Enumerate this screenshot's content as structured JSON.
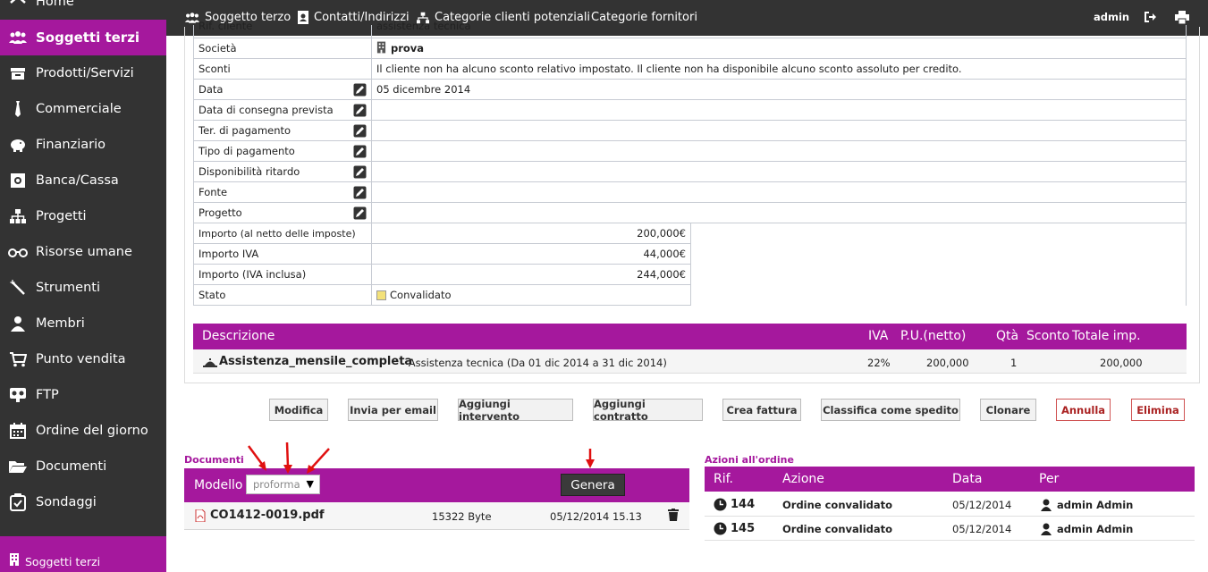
{
  "sidebar": {
    "items": [
      {
        "label": "Home",
        "icon": "home-icon"
      },
      {
        "label": "Soggetti terzi",
        "icon": "users-icon"
      },
      {
        "label": "Prodotti/Servizi",
        "icon": "box-icon"
      },
      {
        "label": "Commerciale",
        "icon": "tie-icon"
      },
      {
        "label": "Finanziario",
        "icon": "piggy-bank-icon"
      },
      {
        "label": "Banca/Cassa",
        "icon": "safe-icon"
      },
      {
        "label": "Progetti",
        "icon": "sitemap-icon"
      },
      {
        "label": "Risorse umane",
        "icon": "glasses-icon"
      },
      {
        "label": "Strumenti",
        "icon": "wand-icon"
      },
      {
        "label": "Membri",
        "icon": "member-icon"
      },
      {
        "label": "Punto vendita",
        "icon": "cart-icon"
      },
      {
        "label": "FTP",
        "icon": "ftp-icon"
      },
      {
        "label": "Ordine del giorno",
        "icon": "calendar-icon"
      },
      {
        "label": "Documenti",
        "icon": "folder-icon"
      },
      {
        "label": "Sondaggi",
        "icon": "survey-icon"
      }
    ],
    "bottom_label": "Soggetti terzi"
  },
  "topbar": {
    "nav": [
      "Soggetto terzo",
      "Contatti/Indirizzi",
      "Categorie clienti potenziali",
      "Categorie fornitori"
    ],
    "user": "admin"
  },
  "info": {
    "rif_label": "Rif. cliente",
    "rif_value": "assistenza tecnica",
    "societa_label": "Società",
    "societa_value": "prova",
    "sconti_label": "Sconti",
    "sconti_value": "Il cliente non ha alcuno sconto relativo impostato. Il cliente non ha disponibile alcuno sconto assoluto per credito.",
    "data_label": "Data",
    "data_value": "05 dicembre 2014",
    "consegna_label": "Data di consegna prevista",
    "termini_label": "Ter. di pagamento",
    "tipo_label": "Tipo di pagamento",
    "disp_label": "Disponibilità ritardo",
    "fonte_label": "Fonte",
    "progetto_label": "Progetto",
    "imp_netto_label": "Importo (al netto delle imposte)",
    "imp_netto_value": "200,000€",
    "imp_iva_label": "Importo IVA",
    "imp_iva_value": "44,000€",
    "imp_tot_label": "Importo (IVA inclusa)",
    "imp_tot_value": "244,000€",
    "stato_label": "Stato",
    "stato_value": "Convalidato"
  },
  "lines": {
    "headers": {
      "descrizione": "Descrizione",
      "iva": "IVA",
      "pu": "P.U.(netto)",
      "qta": "Qtà",
      "sconto": "Sconto",
      "totale": "Totale imp."
    },
    "row": {
      "product": "Assistenza_mensile_completa",
      "desc": " - Assistenza tecnica (Da 01 dic 2014 a 31 dic 2014)",
      "iva": "22%",
      "pu": "200,000",
      "qta": "1",
      "totale": "200,000"
    }
  },
  "actions": [
    "Modifica",
    "Invia per email",
    "Aggiungi intervento",
    "Aggiungi contratto",
    "Crea fattura",
    "Classifica come spedito",
    "Clonare",
    "Annulla",
    "Elimina"
  ],
  "documents": {
    "title": "Documenti",
    "model_label": "Modello",
    "model_value": "proforma",
    "generate_label": "Genera",
    "file": {
      "name": "CO1412-0019.pdf",
      "size": "15322 Byte",
      "date": "05/12/2014 15.13"
    }
  },
  "azioni": {
    "title": "Azioni all'ordine",
    "headers": {
      "rif": "Rif.",
      "azione": "Azione",
      "data": "Data",
      "per": "Per"
    },
    "rows": [
      {
        "rif": "144",
        "azione": "Ordine convalidato",
        "data": "05/12/2014",
        "per": "admin Admin"
      },
      {
        "rif": "145",
        "azione": "Ordine convalidato",
        "data": "05/12/2014",
        "per": "admin Admin"
      }
    ]
  },
  "colors": {
    "accent": "#a5189d",
    "dark": "#333333",
    "annotation": "#e01010"
  }
}
